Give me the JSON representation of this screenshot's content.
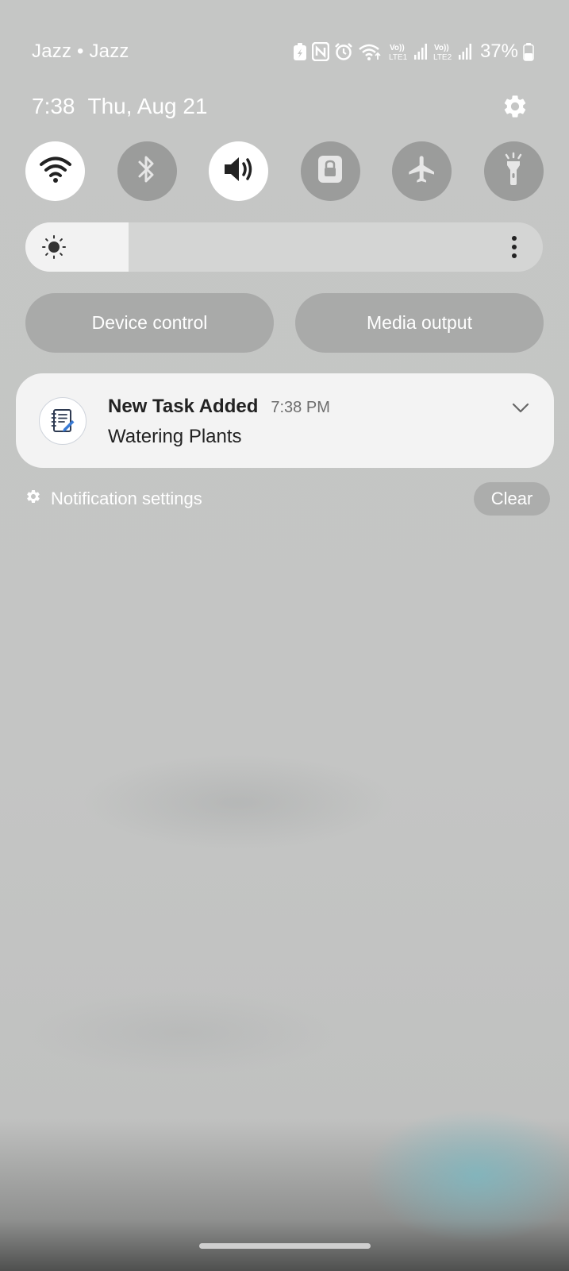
{
  "status_bar": {
    "carrier": "Jazz • Jazz",
    "sim1_label": "Vo)) LTE1",
    "sim2_label": "Vo)) LTE2",
    "battery": "37%",
    "icons": [
      "battery-saver-icon",
      "nfc-icon",
      "alarm-icon",
      "wifi-icon",
      "signal-icon",
      "battery-icon"
    ]
  },
  "header": {
    "time": "7:38",
    "date": "Thu, Aug 21"
  },
  "quick_toggles": [
    {
      "name": "wifi",
      "icon": "wifi-icon",
      "active": true
    },
    {
      "name": "bluetooth",
      "icon": "bluetooth-icon",
      "active": false
    },
    {
      "name": "sound",
      "icon": "volume-icon",
      "active": true
    },
    {
      "name": "rotation-lock",
      "icon": "lock-icon",
      "active": false
    },
    {
      "name": "airplane-mode",
      "icon": "airplane-icon",
      "active": false
    },
    {
      "name": "flashlight",
      "icon": "flashlight-icon",
      "active": false
    }
  ],
  "brightness": {
    "level": 0.2
  },
  "controls": {
    "device_control": "Device control",
    "media_output": "Media output"
  },
  "notification": {
    "app_icon": "notepad-icon",
    "title": "New Task Added",
    "time": "7:38 PM",
    "body": "Watering Plants"
  },
  "footer": {
    "settings_label": "Notification settings",
    "clear_label": "Clear"
  },
  "colors": {
    "panel_bg": "#c6c7c6",
    "toggle_on": "#ffffff",
    "toggle_off": "#9b9c9b",
    "card_bg": "#f3f3f3",
    "accent_blue": "#3a7bd5"
  }
}
